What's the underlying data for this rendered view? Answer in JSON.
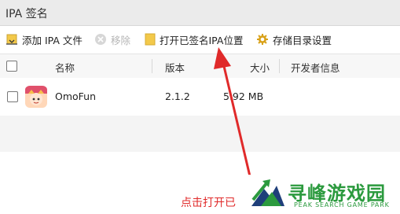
{
  "window": {
    "title": "IPA 签名"
  },
  "toolbar": {
    "add_label": "添加 IPA 文件",
    "remove_label": "移除",
    "open_location_label": "打开已签名IPA位置",
    "settings_label": "存储目录设置"
  },
  "table": {
    "columns": {
      "name": "名称",
      "version": "版本",
      "size": "大小",
      "developer": "开发者信息"
    },
    "rows": [
      {
        "name": "OmoFun",
        "version": "2.1.2",
        "size": "5.92 MB",
        "developer": ""
      }
    ]
  },
  "annotation": {
    "text": "点击打开已"
  },
  "watermark": {
    "name": "寻峰游戏园",
    "subtitle": "PEAK SEARCH GAME PARK"
  },
  "colors": {
    "annotation": "#e02a2a",
    "watermark": "#2b9a3e",
    "folder": "#f3c94a",
    "gear": "#d9a21b"
  }
}
